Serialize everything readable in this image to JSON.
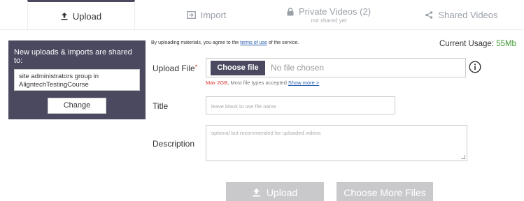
{
  "tabs": [
    {
      "label": "Upload",
      "icon": "upload-icon"
    },
    {
      "label": "Import",
      "icon": "import-icon"
    },
    {
      "label": "Private Videos (2)",
      "sublabel": "not shared yet",
      "icon": "lock-icon"
    },
    {
      "label": "Shared Videos",
      "icon": "share-icon"
    }
  ],
  "share": {
    "heading": "New uploads & imports are shared to:",
    "group": "site administrators group in AligntechTestingCourse",
    "change_label": "Change"
  },
  "terms": {
    "prefix": "By uploading materials, you agree to the ",
    "link": "terms of use",
    "suffix": " of the service."
  },
  "usage": {
    "label": "Current Usage: ",
    "value": "55Mb"
  },
  "form": {
    "file_label": "Upload File",
    "required_mark": "*",
    "choose_file": "Choose file",
    "no_file": "No file chosen",
    "hint_max": "Max 2GB",
    "hint_rest": ", Most file types accepted",
    "show_more": "Show more >",
    "title_label": "Title",
    "title_placeholder": "leave blank to use file name",
    "desc_label": "Description",
    "desc_placeholder": "optional but recommended for uploaded videos"
  },
  "buttons": {
    "upload": "Upload",
    "choose_more": "Choose More Files"
  },
  "colors": {
    "accent": "#4a4960",
    "usage": "#3f9a2f",
    "required": "#dd3333",
    "disabled": "#c9c9cb"
  }
}
